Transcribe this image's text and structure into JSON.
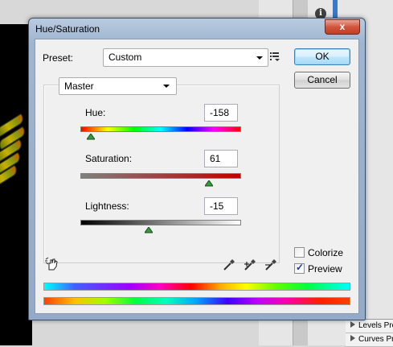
{
  "window": {
    "title": "Hue/Saturation",
    "close_glyph": "x"
  },
  "preset": {
    "label": "Preset:",
    "value": "Custom"
  },
  "buttons": {
    "ok": "OK",
    "cancel": "Cancel"
  },
  "channel": {
    "value": "Master"
  },
  "sliders": {
    "hue": {
      "label": "Hue:",
      "value": "-158",
      "range": [
        -180,
        180
      ]
    },
    "saturation": {
      "label": "Saturation:",
      "value": "61",
      "range": [
        -100,
        100
      ]
    },
    "lightness": {
      "label": "Lightness:",
      "value": "-15",
      "range": [
        -100,
        100
      ]
    }
  },
  "options": {
    "colorize": {
      "label": "Colorize",
      "checked": false
    },
    "preview": {
      "label": "Preview",
      "checked": true
    }
  },
  "background_panels": {
    "row1": "Levels Pres",
    "row2": "Curves Pre"
  },
  "background_info_glyph": "i",
  "colors": {
    "accent": "#3c7fb1",
    "thumb_green": "#2e9d3a",
    "close_red": "#c23e22"
  },
  "icons": {
    "preset_options": "list-menu-icon",
    "targeted_adjustment": "hand-target-icon",
    "eyedropper": "eyedropper-icon",
    "eyedropper_add": "eyedropper-plus-icon",
    "eyedropper_subtract": "eyedropper-minus-icon"
  }
}
